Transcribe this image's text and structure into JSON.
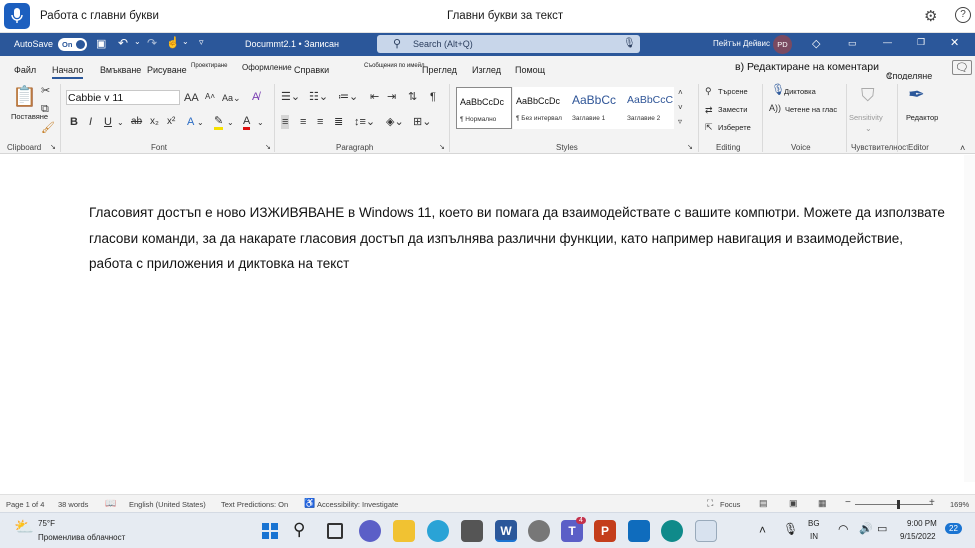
{
  "voice_access": {
    "title": "Работа с главни букви",
    "hint": "Главни букви за текст",
    "settings_icon": "gear-icon",
    "help_label": "?"
  },
  "titlebar": {
    "autosave_label": "AutoSave",
    "autosave_state": "On",
    "document_name": "Docummt2.1 • Записан",
    "search_placeholder": "Search (Alt+Q)",
    "user_name": "Пейтън Дейвис",
    "user_initials": "PD"
  },
  "tabs": [
    "Файл",
    "Начало",
    "Вмъкване",
    "Рисуване",
    "Проектиране",
    "Оформление",
    "Справки",
    "Съобщения по имейл",
    "Преглед",
    "Изглед",
    "Помощ"
  ],
  "comment_editing": "в) Редактиране на коментари",
  "share_label": "Споделяне",
  "ribbon": {
    "clipboard": {
      "paste_label": "Поставяне",
      "group_label": "Clipboard"
    },
    "font": {
      "font_name": "Cabbie v 11",
      "group_label": "Font"
    },
    "paragraph": {
      "group_label": "Paragraph"
    },
    "styles": {
      "group_label": "Styles",
      "items": [
        {
          "sample": "AaBbCcDc",
          "name": "¶ Нормално"
        },
        {
          "sample": "AaBbCcDc",
          "name": "¶ Без интервал"
        },
        {
          "sample": "AaBbCc",
          "name": "Заглавие 1"
        },
        {
          "sample": "AaBbCcC",
          "name": "Заглавие 2"
        }
      ]
    },
    "editing": {
      "find": "Търсене",
      "replace": "Замести",
      "select": "Изберете",
      "group_label": "Editing"
    },
    "voice": {
      "dictate": "Диктовка",
      "read_aloud": "Четене на глас",
      "group_label": "Voice"
    },
    "sensitivity": {
      "label": "Sensitivity",
      "group_label": "Чувствителност"
    },
    "editor": {
      "label": "Редактор",
      "group_label": "Editor"
    }
  },
  "document": {
    "text": "Гласовият достъп е ново ИЗЖИВЯВАНЕ в Windows 11, което ви помага да взаимодействате с вашите компютри. Можете да използвате гласови команди, за да накарате гласовия достъп да изпълнява различни функции, като например навигация и взаимодействие, работа с приложения и диктовка на текст"
  },
  "status": {
    "page": "Page 1 of 4",
    "words": "38 words",
    "language": "English (United States)",
    "predictions": "Text Predictions: On",
    "accessibility": "Accessibility: Investigate",
    "focus": "Focus",
    "zoom": "169%"
  },
  "taskbar": {
    "weather_temp": "75°F",
    "weather_desc": "Променлива облачност",
    "lang_1": "BG",
    "lang_2": "IN",
    "time": "9:00 PM",
    "date": "9/15/2022",
    "notifications": "22",
    "teams_badge": "4"
  },
  "colors": {
    "word_blue": "#2b579a",
    "voice_blue": "#1c5fbf",
    "avatar": "#7a4a61"
  }
}
